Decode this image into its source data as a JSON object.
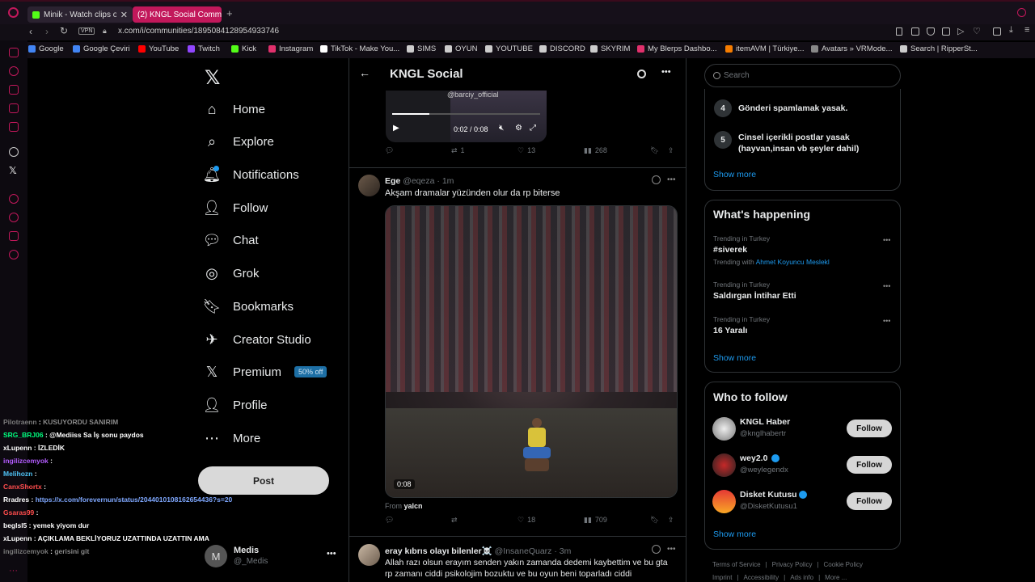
{
  "browser": {
    "tabs": [
      {
        "label": "Minik - Watch clips on"
      },
      {
        "label": "(2) KNGL Social Communi"
      }
    ],
    "vpn_label": "VPN",
    "url": "x.com/i/communities/1895084128954933746",
    "bookmarks": [
      {
        "label": "Google",
        "color": "#4285f4"
      },
      {
        "label": "Google Çeviri",
        "color": "#4285f4"
      },
      {
        "label": "YouTube",
        "color": "#ff0000"
      },
      {
        "label": "Twitch",
        "color": "#9146ff"
      },
      {
        "label": "Kick",
        "color": "#53fc18"
      },
      {
        "label": "Instagram",
        "color": "#e1306c"
      },
      {
        "label": "TikTok - Make You...",
        "color": "#ffffff"
      },
      {
        "label": "SIMS",
        "color": "#cccccc"
      },
      {
        "label": "OYUN",
        "color": "#cccccc"
      },
      {
        "label": "YOUTUBE",
        "color": "#cccccc"
      },
      {
        "label": "DISCORD",
        "color": "#cccccc"
      },
      {
        "label": "SKYRIM",
        "color": "#cccccc"
      },
      {
        "label": "My Blerps Dashbo...",
        "color": "#e1306c"
      },
      {
        "label": "itemAVM | Türkiye...",
        "color": "#f57c00"
      },
      {
        "label": "Avatars » VRMode...",
        "color": "#888888"
      },
      {
        "label": "Search | RipperSt...",
        "color": "#cccccc"
      }
    ]
  },
  "nav": {
    "items": [
      {
        "label": "Home"
      },
      {
        "label": "Explore"
      },
      {
        "label": "Notifications"
      },
      {
        "label": "Follow"
      },
      {
        "label": "Chat"
      },
      {
        "label": "Grok"
      },
      {
        "label": "Bookmarks"
      },
      {
        "label": "Creator Studio"
      },
      {
        "label": "Premium"
      },
      {
        "label": "Profile"
      },
      {
        "label": "More"
      }
    ],
    "premium_badge": "50% off",
    "post_label": "Post",
    "account": {
      "name": "Medis",
      "handle": "@_Medis",
      "avatar_letter": "M"
    }
  },
  "header": {
    "title": "KNGL Social"
  },
  "tweets": [
    {
      "video_watermark": "@barciy_official",
      "video_time": "0:02 / 0:08",
      "replies": "",
      "retweets": "1",
      "likes": "13",
      "views": "268"
    },
    {
      "name": "Ege",
      "handle": "@eqeza",
      "time": "1m",
      "text": "Akşam dramalar yüzünden olur da rp biterse",
      "video_duration": "0:08",
      "from_label": "From",
      "from_user": "yalcn",
      "replies": "",
      "retweets": "",
      "likes": "18",
      "views": "709"
    },
    {
      "name": "eray kıbrıs olayı bilenler☠️",
      "handle": "@InsaneQuarz",
      "time": "3m",
      "text_line1": "Allah razı olsun erayım senden yakın zamanda dedemi kaybettim ve bu gta",
      "text_line2": "rp zamanı ciddi psikolojim bozuktu ve bu oyun beni toparladı ciddi"
    }
  ],
  "search": {
    "placeholder": "Search"
  },
  "rules": [
    {
      "num": "4",
      "text": "Gönderi spamlamak yasak."
    },
    {
      "num": "5",
      "text": "Cinsel içerikli postlar yasak (hayvan,insan vb şeyler dahil)"
    }
  ],
  "rules_show_more": "Show more",
  "happening": {
    "title": "What's happening",
    "trends": [
      {
        "context": "Trending in Turkey",
        "name": "#siverek",
        "with_label": "Trending with",
        "with_link": "Ahmet Koyuncu Meslekl"
      },
      {
        "context": "Trending in Turkey",
        "name": "Saldırgan İntihar Etti"
      },
      {
        "context": "Trending in Turkey",
        "name": "16 Yaralı"
      }
    ],
    "show_more": "Show more"
  },
  "who_to_follow": {
    "title": "Who to follow",
    "accounts": [
      {
        "name": "KNGL Haber",
        "handle": "@knglhabertr",
        "button": "Follow",
        "verified": false
      },
      {
        "name": "wey2.0",
        "handle": "@weylegendx",
        "button": "Follow",
        "verified": true
      },
      {
        "name": "Disket Kutusu",
        "handle": "@DisketKutusu1",
        "button": "Follow",
        "verified": true
      }
    ],
    "show_more": "Show more"
  },
  "footer": {
    "row1": [
      "Terms of Service",
      "Privacy Policy",
      "Cookie Policy"
    ],
    "row2": [
      "Imprint",
      "Accessibility",
      "Ads info",
      "More ..."
    ]
  },
  "chat": [
    {
      "user": "Pilotraenn",
      "msg": "KUSUYORDU SANIRIM",
      "color": "#7a7a7a"
    },
    {
      "user": "SRG_BRJ06",
      "msg": "@Mediiss Sa İş sonu paydos",
      "color": "#00ff7f"
    },
    {
      "user": "xLupenn",
      "msg": "İZLEDİK",
      "color": "#ffffff"
    },
    {
      "user": "ingilizcemyok",
      "msg": "",
      "color": "#b45cff"
    },
    {
      "user": "Melihozn",
      "msg": "",
      "color": "#4fc3f7"
    },
    {
      "user": "CanxShortx",
      "msg": "",
      "color": "#ff4d4d"
    },
    {
      "user": "Rradres",
      "msg": "https://x.com/forevernun/status/2044010108162654436?s=20",
      "color": "#ffffff"
    },
    {
      "user": "Gsaras99",
      "msg": "",
      "color": "#ff4d4d"
    },
    {
      "user": "beglsl5",
      "msg": "yemek yiyom dur",
      "color": "#ffffff"
    },
    {
      "user": "xLupenn",
      "msg": "AÇIKLAMA BEKLİYORUZ UZATTINDA UZATTIN AMA",
      "color": "#ffffff"
    },
    {
      "user": "ingilizcemyok",
      "msg": "gerisini git",
      "color": "#7a7a7a"
    }
  ]
}
